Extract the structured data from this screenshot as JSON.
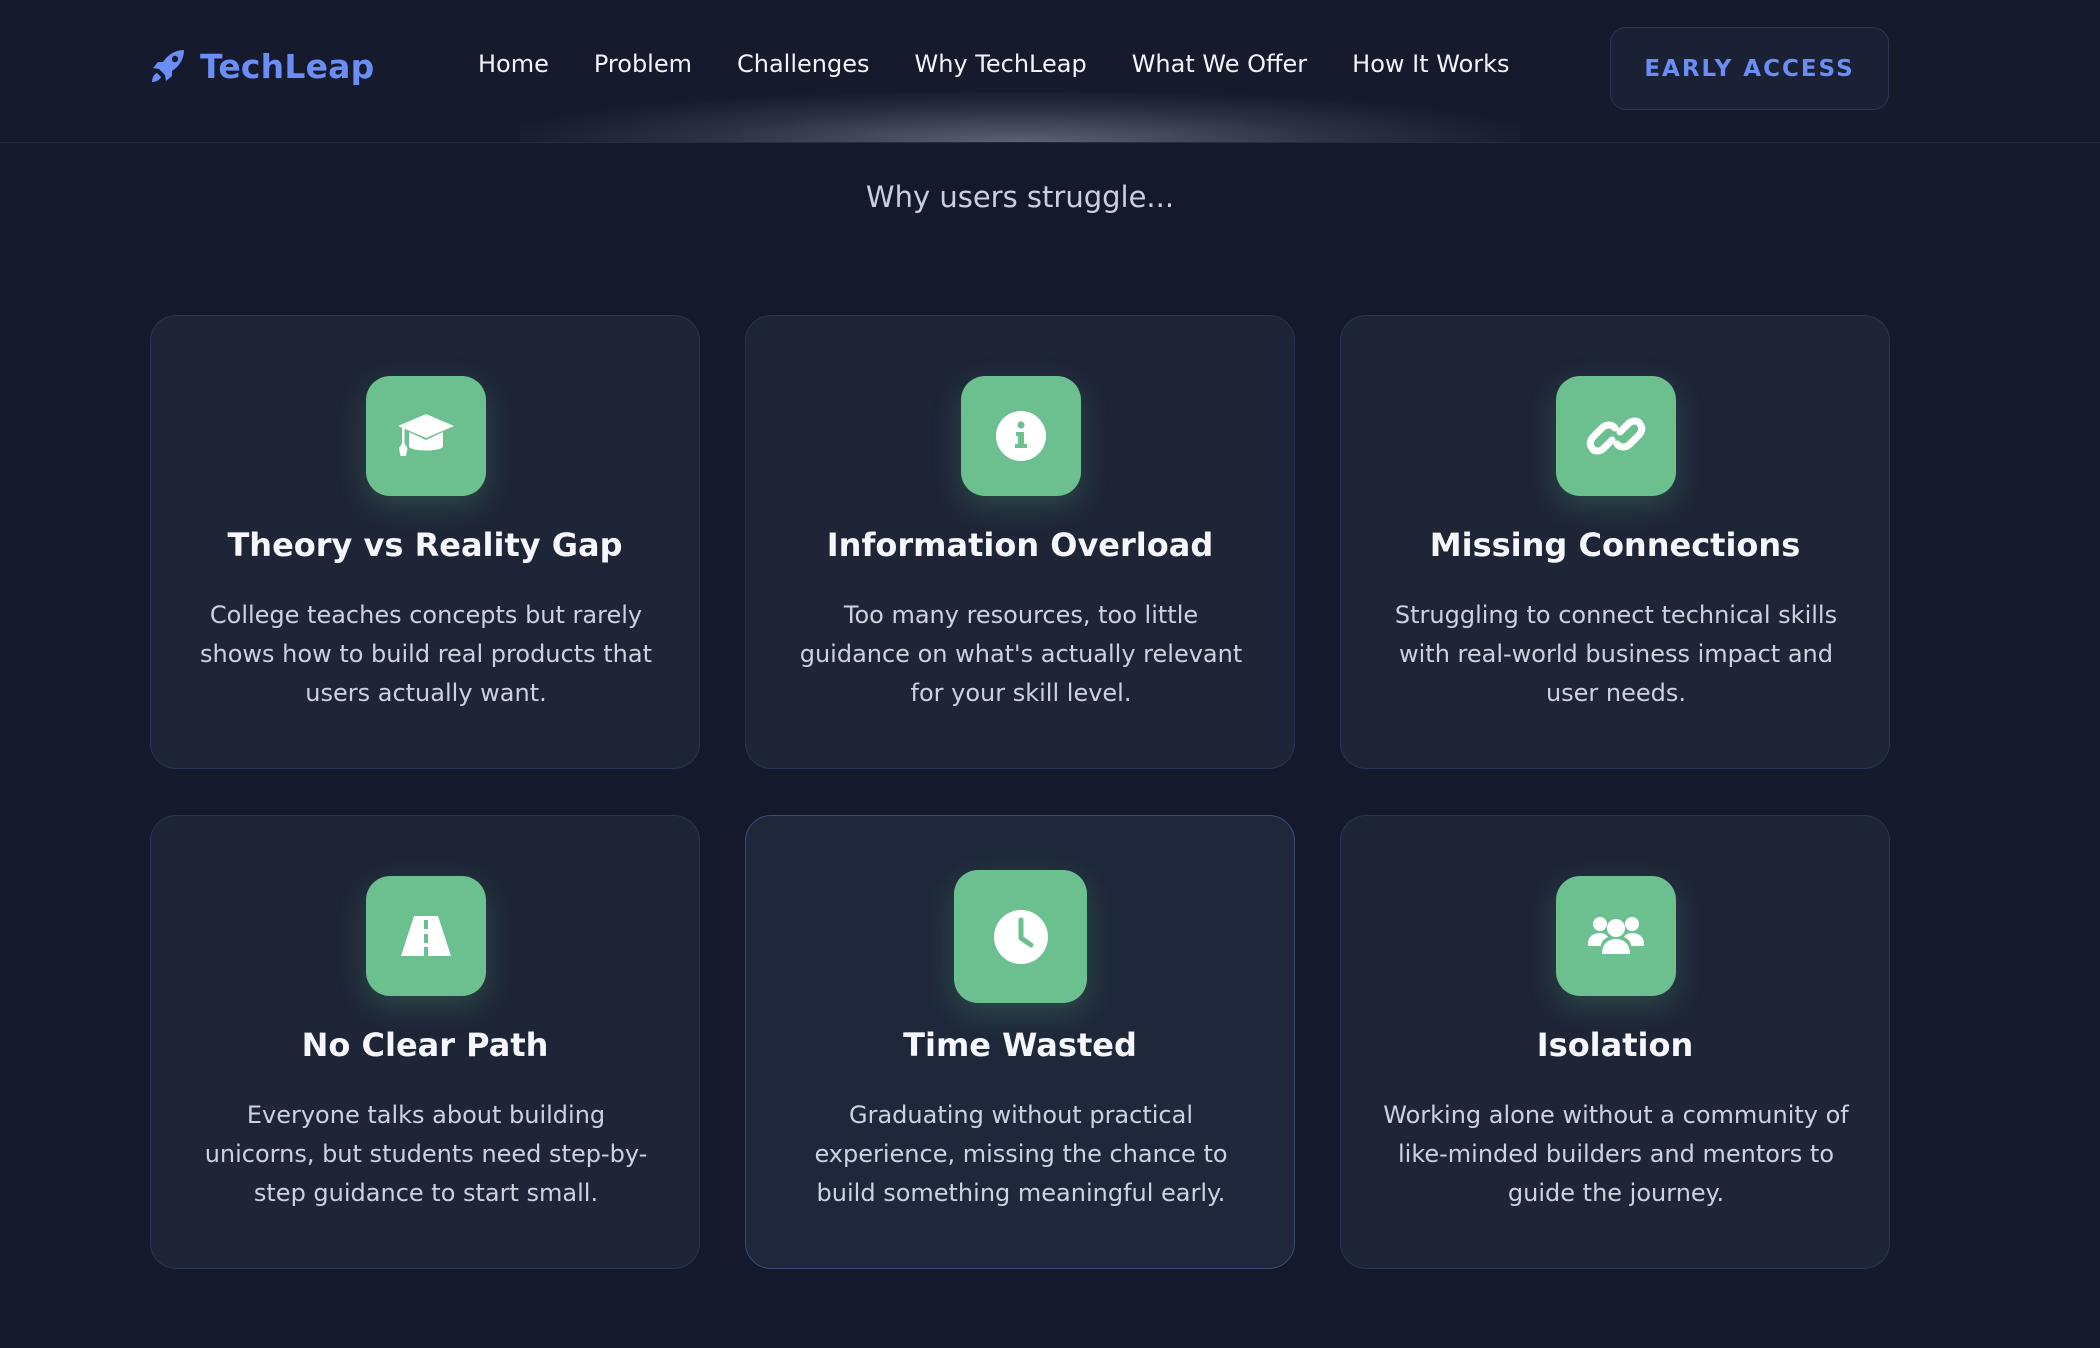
{
  "nav": {
    "logo_text": "TechLeap",
    "links": [
      "Home",
      "Problem",
      "Challenges",
      "Why TechLeap",
      "What We Offer",
      "How It Works"
    ],
    "cta_label": "EARLY ACCESS"
  },
  "section": {
    "subtitle": "Why users struggle..."
  },
  "cards": [
    {
      "icon": "graduation-cap-icon",
      "title": "Theory vs Reality Gap",
      "description": "College teaches concepts but rarely shows how to build real products that users actually want."
    },
    {
      "icon": "info-icon",
      "title": "Information Overload",
      "description": "Too many resources, too little guidance on what's actually relevant for your skill level."
    },
    {
      "icon": "link-icon",
      "title": "Missing Connections",
      "description": "Struggling to connect technical skills with real-world business impact and user needs."
    },
    {
      "icon": "road-icon",
      "title": "No Clear Path",
      "description": "Everyone talks about building unicorns, but students need step-by-step guidance to start small."
    },
    {
      "icon": "clock-icon",
      "title": "Time Wasted",
      "description": "Graduating without practical experience, missing the chance to build something meaningful early."
    },
    {
      "icon": "users-icon",
      "title": "Isolation",
      "description": "Working alone without a community of like-minded builders and mentors to guide the journey."
    }
  ],
  "colors": {
    "background": "#141a2c",
    "accent_blue": "#6b8ef5",
    "icon_green": "#6cbf8e",
    "card_bg": "#1e2537"
  }
}
